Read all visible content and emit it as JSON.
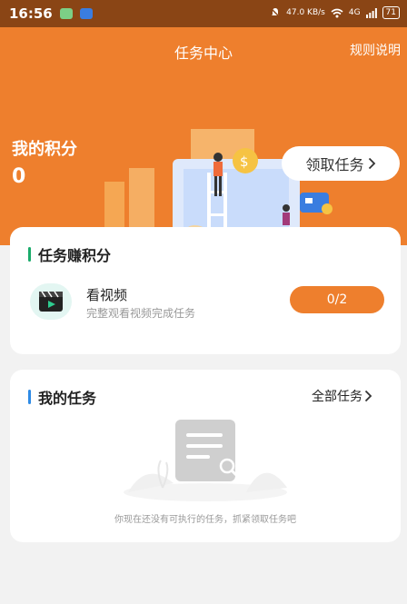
{
  "status_bar": {
    "time": "16:56",
    "net_speed": "47.0 KB/s",
    "signal": "4G",
    "battery": "71"
  },
  "header": {
    "title": "任务中心",
    "rules_link": "规则说明",
    "points_label": "我的积分",
    "points_value": "0",
    "claim_button": "领取任务"
  },
  "earn_section": {
    "title": "任务赚积分",
    "task": {
      "name": "看视频",
      "description": "完整观看视频完成任务",
      "progress": "0/2"
    }
  },
  "my_tasks": {
    "title": "我的任务",
    "all_link": "全部任务",
    "empty_text": "你现在还没有可执行的任务，抓紧领取任务吧"
  },
  "colors": {
    "accent": "#ee7f2d",
    "status_bar": "#8a4515",
    "green_bar": "#1aab6b",
    "blue_bar": "#2e8be6"
  },
  "icons": [
    "chevron-right-icon",
    "video-icon",
    "document-search-icon"
  ]
}
